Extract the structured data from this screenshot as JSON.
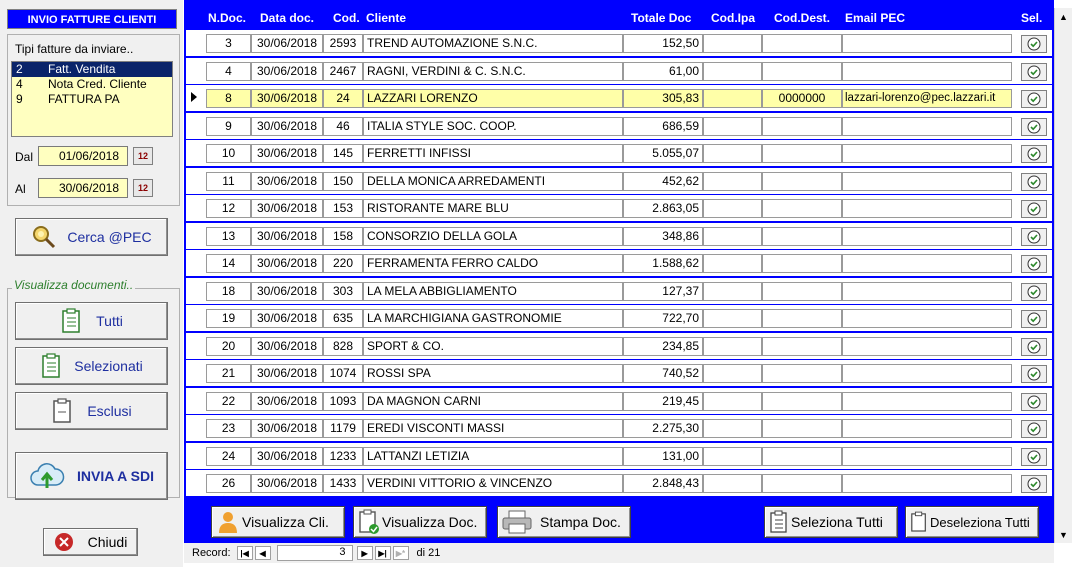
{
  "left_panel": {
    "title": "INVIO FATTURE CLIENTI",
    "types_label": "Tipi fatture da inviare..",
    "types": [
      {
        "code": "2",
        "label": "Fatt. Vendita"
      },
      {
        "code": "4",
        "label": "Nota Cred. Cliente"
      },
      {
        "code": "9",
        "label": "FATTURA PA"
      }
    ],
    "from_label": "Dal",
    "from_value": "01/06/2018",
    "to_label": "Al",
    "to_value": "30/06/2018",
    "search_label": "Cerca @PEC",
    "view_group_label": "Visualizza documenti..",
    "view_all_label": "Tutti",
    "view_selected_label": "Selezionati",
    "view_excluded_label": "Esclusi",
    "send_label": "INVIA A SDI",
    "close_label": "Chiudi"
  },
  "grid": {
    "headers": {
      "ndoc": "N.Doc.",
      "date": "Data doc.",
      "cod": "Cod.",
      "client": "Cliente",
      "total": "Totale Doc",
      "ipa": "Cod.Ipa",
      "dest": "Cod.Dest.",
      "pec": "Email PEC",
      "sel": "Sel."
    },
    "rows": [
      {
        "n": "3",
        "date": "30/06/2018",
        "cod": "2593",
        "client": "TREND AUTOMAZIONE S.N.C.",
        "total": "152,50",
        "ipa": "",
        "dest": "",
        "pec": ""
      },
      {
        "n": "4",
        "date": "30/06/2018",
        "cod": "2467",
        "client": "RAGNI, VERDINI  & C. S.N.C.",
        "total": "61,00",
        "ipa": "",
        "dest": "",
        "pec": ""
      },
      {
        "n": "8",
        "date": "30/06/2018",
        "cod": "24",
        "client": "LAZZARI LORENZO",
        "total": "305,83",
        "ipa": "",
        "dest": "0000000",
        "pec": "lazzari-lorenzo@pec.lazzari.it"
      },
      {
        "n": "9",
        "date": "30/06/2018",
        "cod": "46",
        "client": "ITALIA STYLE SOC. COOP.",
        "total": "686,59",
        "ipa": "",
        "dest": "",
        "pec": ""
      },
      {
        "n": "10",
        "date": "30/06/2018",
        "cod": "145",
        "client": "FERRETTI INFISSI",
        "total": "5.055,07",
        "ipa": "",
        "dest": "",
        "pec": ""
      },
      {
        "n": "11",
        "date": "30/06/2018",
        "cod": "150",
        "client": "DELLA MONICA ARREDAMENTI",
        "total": "452,62",
        "ipa": "",
        "dest": "",
        "pec": ""
      },
      {
        "n": "12",
        "date": "30/06/2018",
        "cod": "153",
        "client": "RISTORANTE MARE BLU",
        "total": "2.863,05",
        "ipa": "",
        "dest": "",
        "pec": ""
      },
      {
        "n": "13",
        "date": "30/06/2018",
        "cod": "158",
        "client": "CONSORZIO DELLA GOLA",
        "total": "348,86",
        "ipa": "",
        "dest": "",
        "pec": ""
      },
      {
        "n": "14",
        "date": "30/06/2018",
        "cod": "220",
        "client": "FERRAMENTA FERRO CALDO",
        "total": "1.588,62",
        "ipa": "",
        "dest": "",
        "pec": ""
      },
      {
        "n": "18",
        "date": "30/06/2018",
        "cod": "303",
        "client": "LA MELA ABBIGLIAMENTO",
        "total": "127,37",
        "ipa": "",
        "dest": "",
        "pec": ""
      },
      {
        "n": "19",
        "date": "30/06/2018",
        "cod": "635",
        "client": "LA MARCHIGIANA GASTRONOMIE",
        "total": "722,70",
        "ipa": "",
        "dest": "",
        "pec": ""
      },
      {
        "n": "20",
        "date": "30/06/2018",
        "cod": "828",
        "client": "SPORT & CO.",
        "total": "234,85",
        "ipa": "",
        "dest": "",
        "pec": ""
      },
      {
        "n": "21",
        "date": "30/06/2018",
        "cod": "1074",
        "client": "ROSSI SPA",
        "total": "740,52",
        "ipa": "",
        "dest": "",
        "pec": ""
      },
      {
        "n": "22",
        "date": "30/06/2018",
        "cod": "1093",
        "client": "DA MAGNON CARNI",
        "total": "219,45",
        "ipa": "",
        "dest": "",
        "pec": ""
      },
      {
        "n": "23",
        "date": "30/06/2018",
        "cod": "1179",
        "client": "EREDI VISCONTI MASSI",
        "total": "2.275,30",
        "ipa": "",
        "dest": "",
        "pec": ""
      },
      {
        "n": "24",
        "date": "30/06/2018",
        "cod": "1233",
        "client": "LATTANZI LETIZIA",
        "total": "131,00",
        "ipa": "",
        "dest": "",
        "pec": ""
      },
      {
        "n": "26",
        "date": "30/06/2018",
        "cod": "1433",
        "client": "VERDINI VITTORIO & VINCENZO",
        "total": "2.848,43",
        "ipa": "",
        "dest": "",
        "pec": ""
      }
    ]
  },
  "toolbar": {
    "view_client_label": "Visualizza Cli.",
    "view_doc_label": "Visualizza Doc.",
    "print_doc_label": "Stampa Doc.",
    "select_all_label": "Seleziona Tutti",
    "deselect_all_label": "Deseleziona Tutti"
  },
  "navigation": {
    "record_label": "Record:",
    "current": "3",
    "total_label": "di 21"
  },
  "colors": {
    "accent_blue": "#0000ff",
    "field_yellow": "#ffffc0",
    "selected_row": "#ffffa8"
  }
}
